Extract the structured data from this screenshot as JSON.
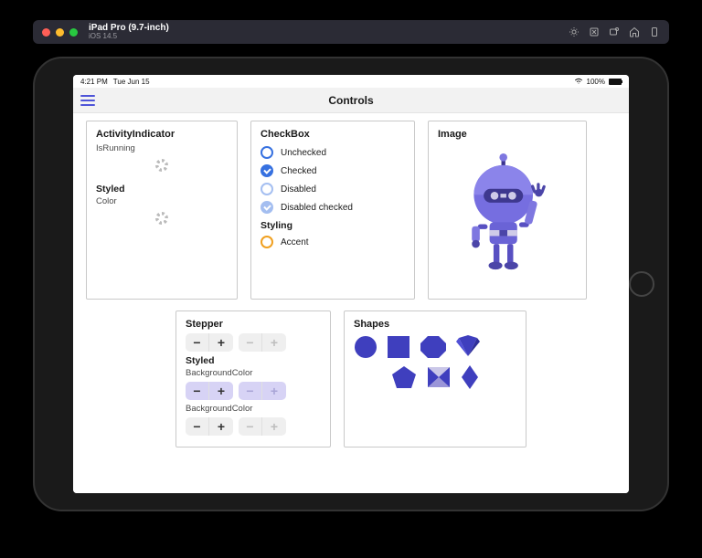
{
  "window": {
    "device_label": "iPad Pro (9.7-inch)",
    "os_label": "iOS 14.5"
  },
  "statusbar": {
    "time": "4:21 PM",
    "date": "Tue Jun 15",
    "battery_text": "100%"
  },
  "navbar": {
    "title": "Controls"
  },
  "cards": {
    "activity": {
      "title": "ActivityIndicator",
      "prop1": "IsRunning",
      "styled": "Styled",
      "prop2": "Color"
    },
    "checkbox": {
      "title": "CheckBox",
      "items": [
        {
          "label": "Unchecked",
          "state": "unchecked"
        },
        {
          "label": "Checked",
          "state": "checked"
        },
        {
          "label": "Disabled",
          "state": "disabled"
        },
        {
          "label": "Disabled checked",
          "state": "disabled-checked"
        }
      ],
      "styling_label": "Styling",
      "accent_label": "Accent"
    },
    "image": {
      "title": "Image"
    },
    "stepper": {
      "title": "Stepper",
      "styled": "Styled",
      "prop1": "BackgroundColor",
      "prop2": "BackgroundColor"
    },
    "shapes": {
      "title": "Shapes"
    }
  },
  "colors": {
    "accent": "#5450c8",
    "shapeFill": "#3f3fbe"
  }
}
